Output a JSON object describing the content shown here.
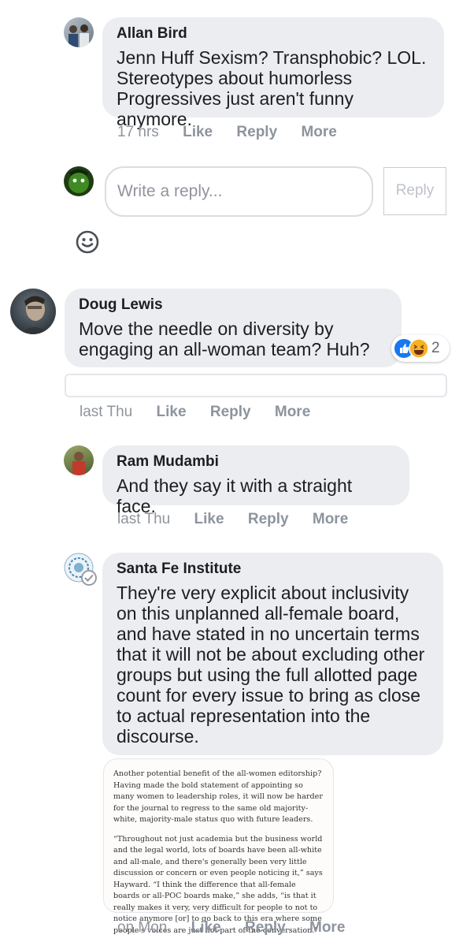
{
  "comments": [
    {
      "author": "Allan Bird",
      "text": "Jenn Huff Sexism? Transphobic? LOL.\nStereotypes about humorless\nProgressives just aren't funny anymore.",
      "time": "17 hrs",
      "like": "Like",
      "reply": "Reply",
      "more": "More"
    },
    {
      "author": "Doug Lewis",
      "text": "Move the needle on diversity by\nengaging an all-woman team? Huh?",
      "reaction_count": "2",
      "time": "last Thu",
      "like": "Like",
      "reply": "Reply",
      "more": "More"
    },
    {
      "author": "Ram Mudambi",
      "text": "And they say it with a straight face.",
      "time": "last Thu",
      "like": "Like",
      "reply": "Reply",
      "more": "More"
    },
    {
      "author": "Santa Fe Institute",
      "text": "They're very explicit about inclusivity\non this unplanned all-female board,\nand have stated in no uncertain terms\nthat it will not be about excluding other\ngroups but using the full allotted page\ncount for every issue to bring as close\nto actual representation into the\ndiscourse.",
      "time": "on Mon",
      "like": "Like",
      "reply": "Reply",
      "more": "More"
    }
  ],
  "reply_box": {
    "placeholder": "Write a reply...",
    "button": "Reply"
  },
  "quote_image": {
    "paragraph1": "Another potential benefit of the all-women editorship? Having made the bold statement of appointing so many women to leadership roles, it will now be harder for the journal to regress to the same old majority-white, majority-male status quo with future leaders.",
    "paragraph2": "“Throughout not just academia but the business world and the legal world, lots of boards have been all-white and all-male, and there's generally been very little discussion or concern or even people noticing it,” says Hayward. “I think the difference that all-female boards or all-POC boards make,” she adds, “is that it really makes it very, very difficult for people to not to notice anymore [or] to go back to this era where some people's voices are just not part of the conversation.”"
  },
  "colors": {
    "bubble": "#ebedf0",
    "meta": "#90949c",
    "like_blue": "#1877f2",
    "haha_yellow": "#f7b125"
  }
}
